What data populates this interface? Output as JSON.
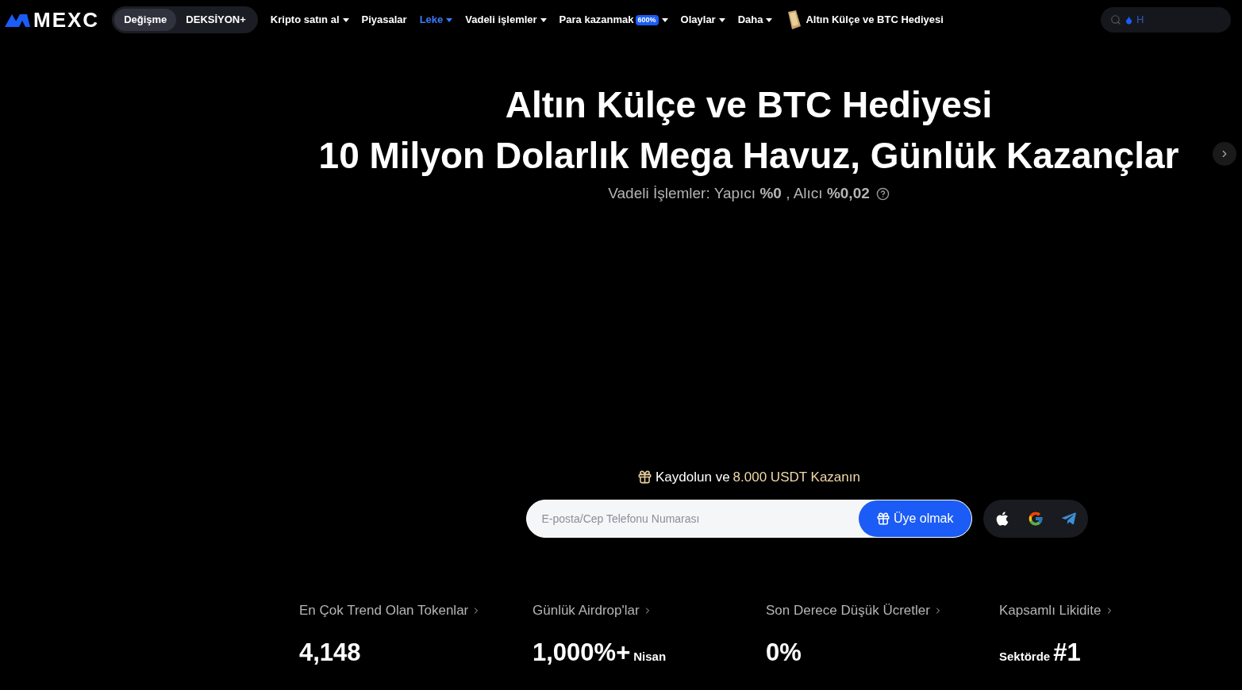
{
  "nav": {
    "logo": "MEXC",
    "toggle": [
      {
        "label": "Değişme",
        "selected": true
      },
      {
        "label": "DEKSİYON+",
        "selected": false
      }
    ],
    "menu": [
      {
        "label": "Kripto satın al",
        "caret": true,
        "selected": false
      },
      {
        "label": "Piyasalar",
        "caret": false,
        "selected": false
      },
      {
        "label": "Leke",
        "caret": true,
        "selected": true
      },
      {
        "label": "Vadeli işlemler",
        "caret": true,
        "selected": false
      },
      {
        "label": "Para kazanmak",
        "badge": "600%",
        "caret": true,
        "selected": false
      },
      {
        "label": "Olaylar",
        "caret": true,
        "selected": false
      },
      {
        "label": "Daha",
        "caret": true,
        "selected": false
      },
      {
        "label": "Altın Külçe ve BTC Hediyesi",
        "kind": "gift",
        "caret": false,
        "selected": false
      }
    ],
    "search": {
      "placeholder": "H"
    }
  },
  "hero": {
    "title": [
      "Altın Külçe ve BTC Hediyesi",
      "10 Milyon Dolarlık Mega Havuz, Günlük Kazançlar"
    ],
    "subtitle": "Vadeli İşlemler: Yapıcı **%0** , Alıcı **%0,02**",
    "promo": {
      "text": "Kaydolun ve",
      "highlight": "8.000 USDT Kazanın"
    },
    "signup": {
      "placeholder": "E-posta/Cep Telefonu Numarası",
      "button": "Üye olmak"
    }
  },
  "stats": [
    {
      "label": "En Çok Trend Olan Tokenlar",
      "value": "4,148"
    },
    {
      "label": "Günlük Airdrop'lar",
      "value": "1,000%+",
      "small": "Nisan",
      "kind": "suffix"
    },
    {
      "label": "Son Derece Düşük Ücretler",
      "value": "0%"
    },
    {
      "label": "Kapsamlı Likidite",
      "value": "#1",
      "small": "Sektörde",
      "kind": "prefix"
    }
  ]
}
